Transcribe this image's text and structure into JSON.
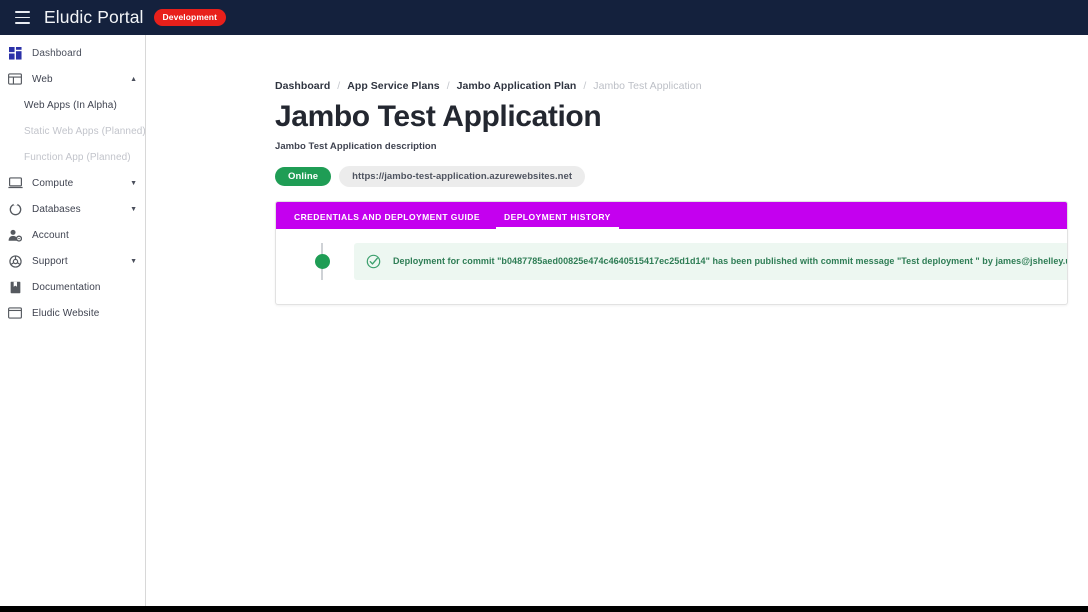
{
  "header": {
    "menu_icon": "hamburger-menu-icon",
    "brand": "Eludic Portal",
    "env_badge": "Development",
    "bg_color": "#14213d",
    "badge_color": "#e8201b"
  },
  "sidebar": {
    "items": [
      {
        "label": "Dashboard",
        "icon": "dashboard-grid-icon",
        "level": "top",
        "state": "enabled",
        "expandable": false
      },
      {
        "label": "Web",
        "icon": "web-window-icon",
        "level": "top",
        "state": "enabled",
        "expandable": true,
        "expanded": true,
        "caret": "▲"
      },
      {
        "label": "Web Apps (In Alpha)",
        "icon": "",
        "level": "sub",
        "state": "enabled",
        "expandable": false
      },
      {
        "label": "Static Web Apps (Planned)",
        "icon": "",
        "level": "sub",
        "state": "disabled",
        "expandable": false
      },
      {
        "label": "Function App (Planned)",
        "icon": "",
        "level": "sub",
        "state": "disabled",
        "expandable": false
      },
      {
        "label": "Compute",
        "icon": "laptop-icon",
        "level": "top",
        "state": "enabled",
        "expandable": true,
        "expanded": false,
        "caret": "▼"
      },
      {
        "label": "Databases",
        "icon": "database-circle-icon",
        "level": "top",
        "state": "enabled",
        "expandable": true,
        "expanded": false,
        "caret": "▼"
      },
      {
        "label": "Account",
        "icon": "user-gear-icon",
        "level": "top",
        "state": "enabled",
        "expandable": false
      },
      {
        "label": "Support",
        "icon": "lifebuoy-icon",
        "level": "top",
        "state": "enabled",
        "expandable": true,
        "expanded": false,
        "caret": "▼"
      },
      {
        "label": "Documentation",
        "icon": "book-icon",
        "level": "top",
        "state": "enabled",
        "expandable": false
      },
      {
        "label": "Eludic Website",
        "icon": "browser-window-icon",
        "level": "top",
        "state": "enabled",
        "expandable": false
      }
    ]
  },
  "breadcrumb": {
    "separator": "/",
    "items": [
      {
        "label": "Dashboard",
        "current": false
      },
      {
        "label": "App Service Plans",
        "current": false
      },
      {
        "label": "Jambo Application Plan",
        "current": false
      },
      {
        "label": "Jambo Test Application",
        "current": true
      }
    ]
  },
  "page": {
    "title": "Jambo Test Application",
    "description": "Jambo Test Application description",
    "status_badge": "Online",
    "status_color": "#1f9d55",
    "url": "https://jambo-test-application.azurewebsites.net"
  },
  "tabs": {
    "accent_color": "#c400ef",
    "items": [
      {
        "label": "CREDENTIALS AND DEPLOYMENT GUIDE",
        "active": false
      },
      {
        "label": "DEPLOYMENT HISTORY",
        "active": true
      }
    ]
  },
  "deployment_history": {
    "entries": [
      {
        "icon": "check-circle-icon",
        "text": "Deployment for commit \"b0487785aed00825e474c4640515417ec25d1d14\" has been published with commit message \"Test deployment \" by james@jshelley.uk.",
        "status_color": "#1f9d55"
      }
    ]
  }
}
